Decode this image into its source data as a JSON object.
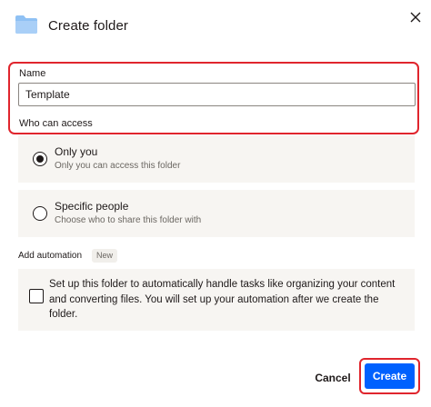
{
  "dialog": {
    "title": "Create folder",
    "close_icon": "close-icon",
    "folder_icon": "folder-icon"
  },
  "name_field": {
    "label": "Name",
    "value": "Template"
  },
  "access": {
    "label": "Who can access",
    "options": [
      {
        "title": "Only you",
        "subtitle": "Only you can access this folder",
        "selected": true
      },
      {
        "title": "Specific people",
        "subtitle": "Choose who to share this folder with",
        "selected": false
      }
    ]
  },
  "automation": {
    "label": "Add automation",
    "badge": "New",
    "checkbox_text": "Set up this folder to automatically handle tasks like organizing your content and converting files. You will set up your automation after we create the folder.",
    "checked": false
  },
  "footer": {
    "cancel_label": "Cancel",
    "create_label": "Create"
  },
  "colors": {
    "primary": "#0061fe",
    "highlight": "#e0252d",
    "card_bg": "#f7f5f2",
    "folder_icon": "#8fc1f4"
  }
}
